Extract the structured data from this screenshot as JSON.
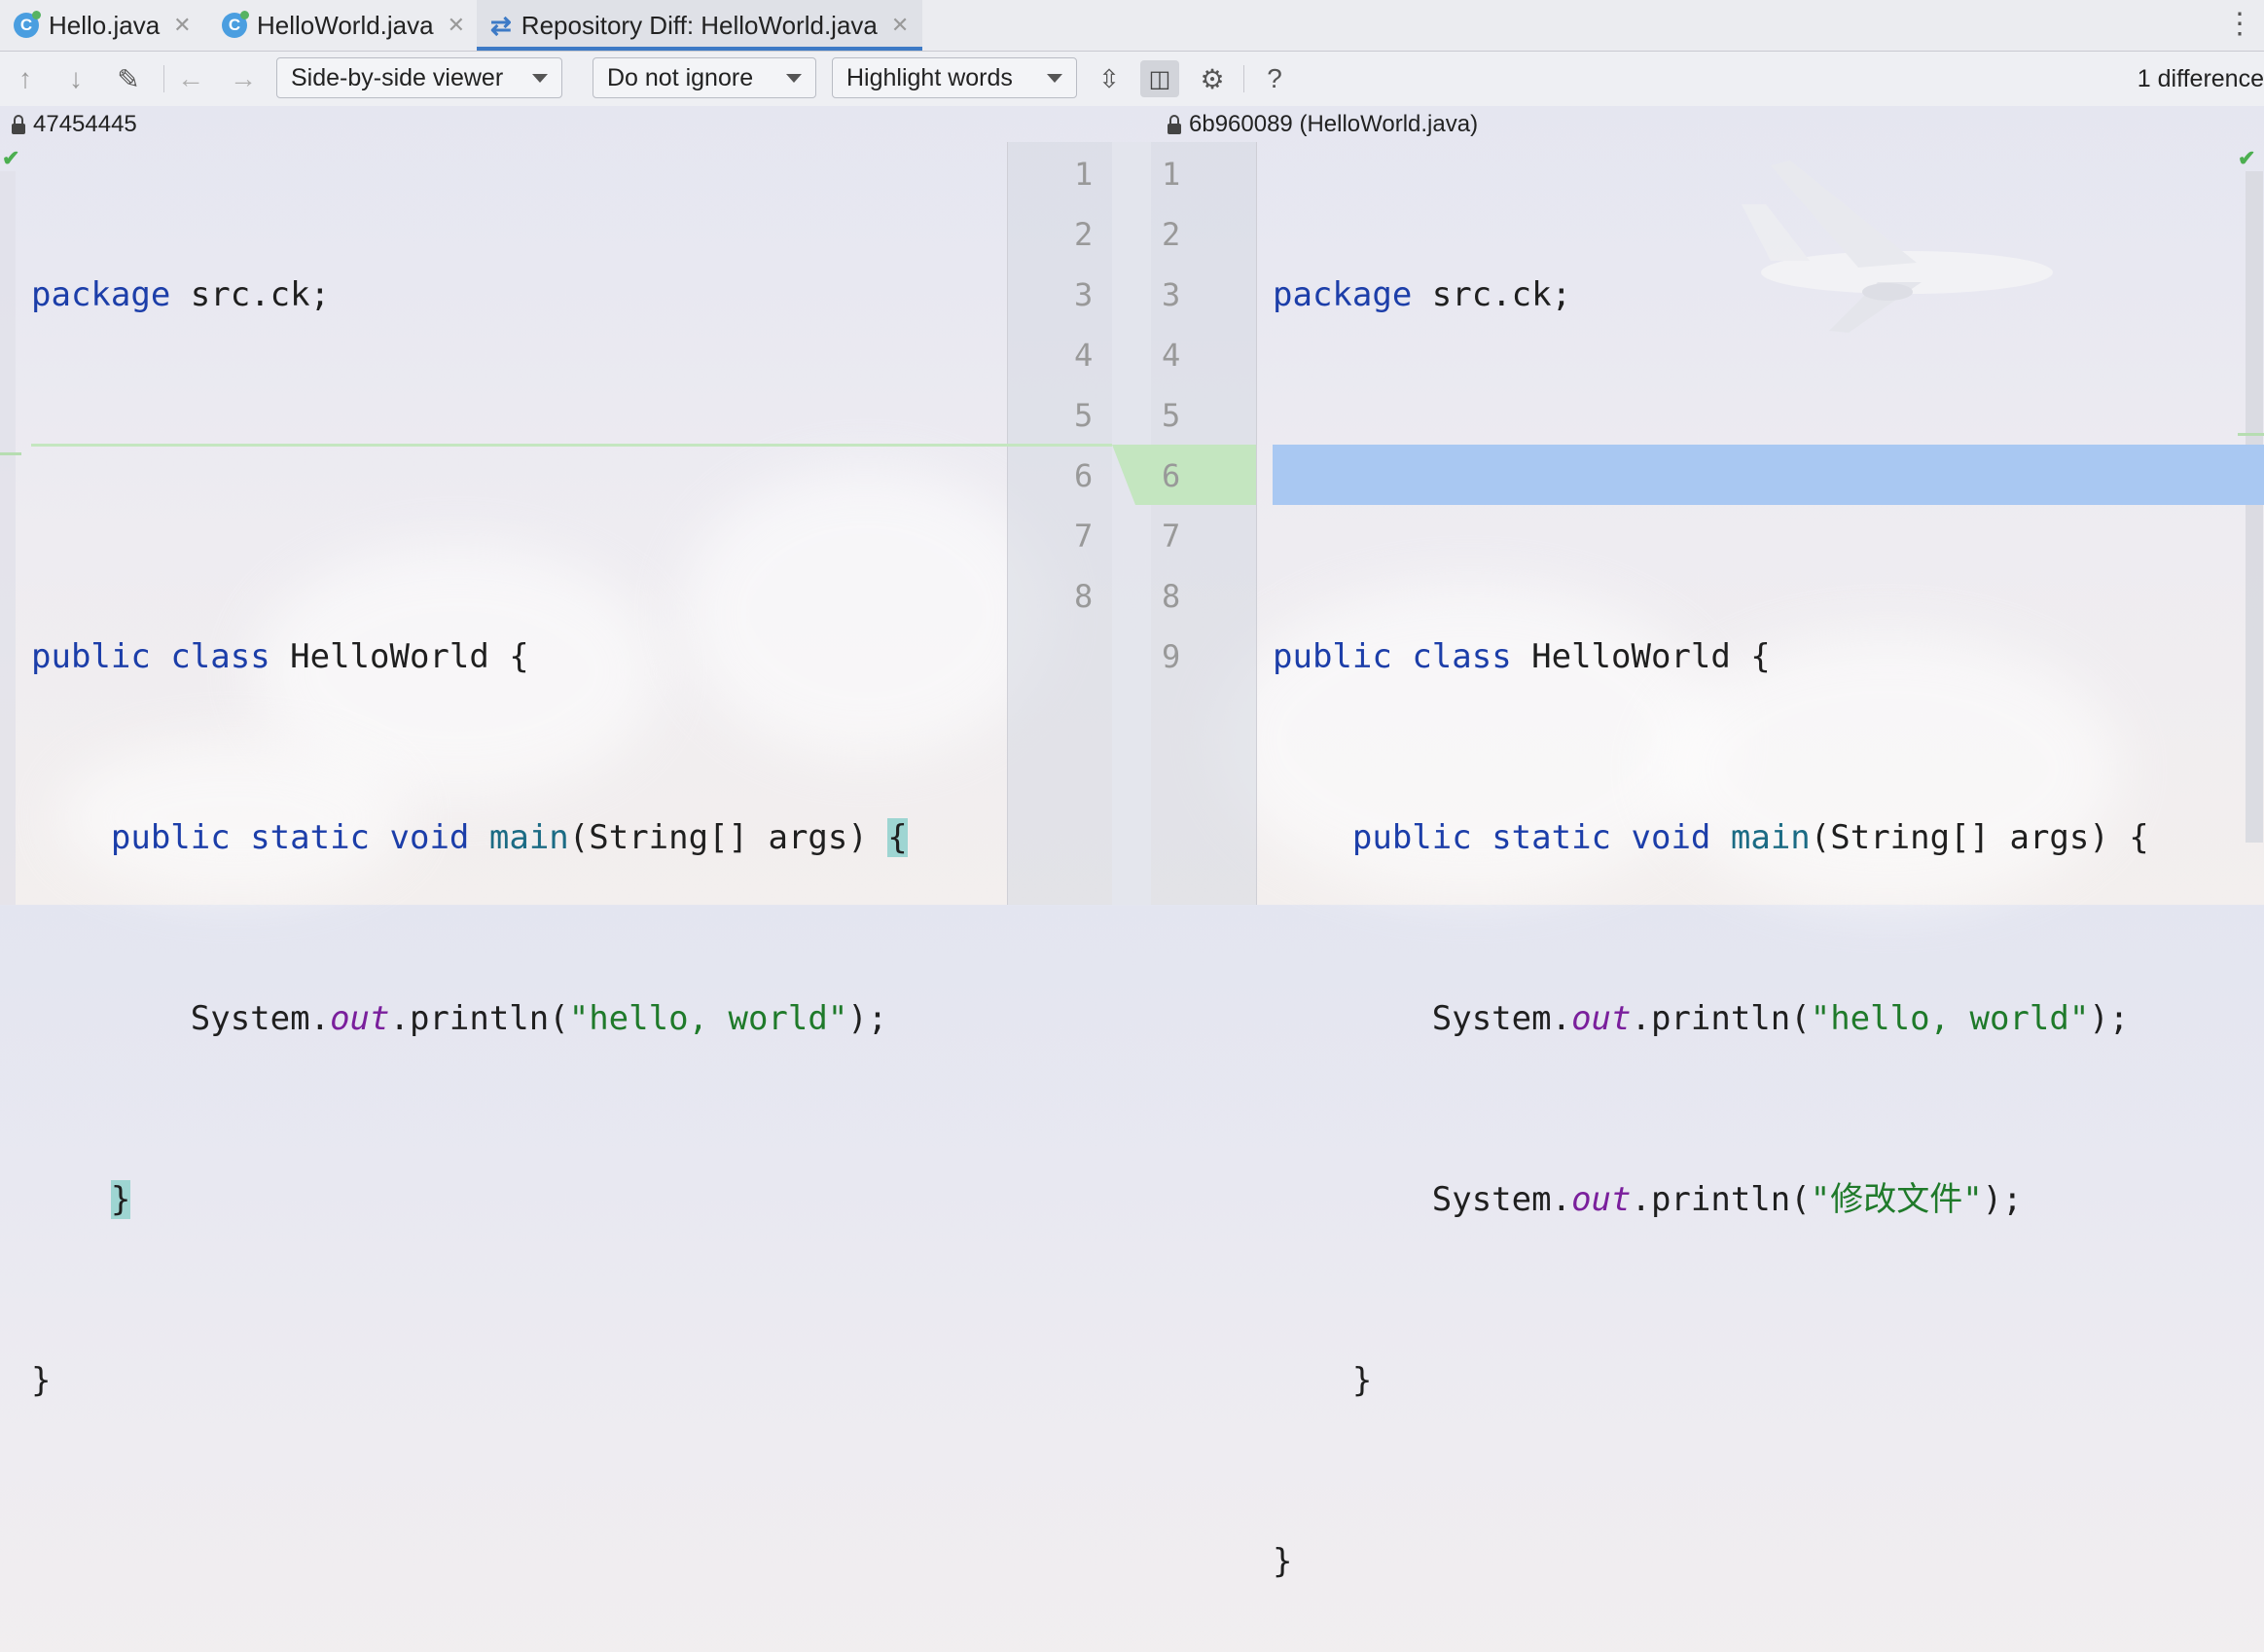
{
  "tabs": [
    {
      "label": "Hello.java",
      "icon": "java-class-icon",
      "active": false
    },
    {
      "label": "HelloWorld.java",
      "icon": "java-class-icon",
      "active": false
    },
    {
      "label": "Repository Diff: HelloWorld.java",
      "icon": "diff-icon",
      "active": true
    }
  ],
  "toolbar": {
    "viewer": "Side-by-side viewer",
    "ignore": "Do not ignore",
    "highlight": "Highlight words",
    "help": "?",
    "difference_count": "1 difference"
  },
  "left": {
    "header": "47454445",
    "line_numbers": [
      "1",
      "2",
      "3",
      "4",
      "5",
      "6",
      "7",
      "8"
    ]
  },
  "right": {
    "header": "6b960089 (HelloWorld.java)",
    "line_numbers": [
      "1",
      "2",
      "3",
      "4",
      "5",
      "6",
      "7",
      "8",
      "9"
    ]
  },
  "code": {
    "package_kw": "package",
    "package_name": " src.ck;",
    "public_kw": "public",
    "class_kw": "class",
    "class_name": " HelloWorld {",
    "static_kw": "static",
    "void_kw": "void",
    "main_fn": "main",
    "main_params": "(String[] args) ",
    "open_brace": "{",
    "system": "System.",
    "out": "out",
    "println": ".println(",
    "hello_str": "\"hello, world\"",
    "changed_str": "\"修改文件\"",
    "stmt_end": ");",
    "close_brace": "}"
  },
  "colors": {
    "keyword": "#1c3ea9",
    "string": "#1f7a2a",
    "field": "#7a1f9c",
    "inserted_line": "#a9c8f2",
    "inserted_gutter": "#c4e6c0"
  }
}
